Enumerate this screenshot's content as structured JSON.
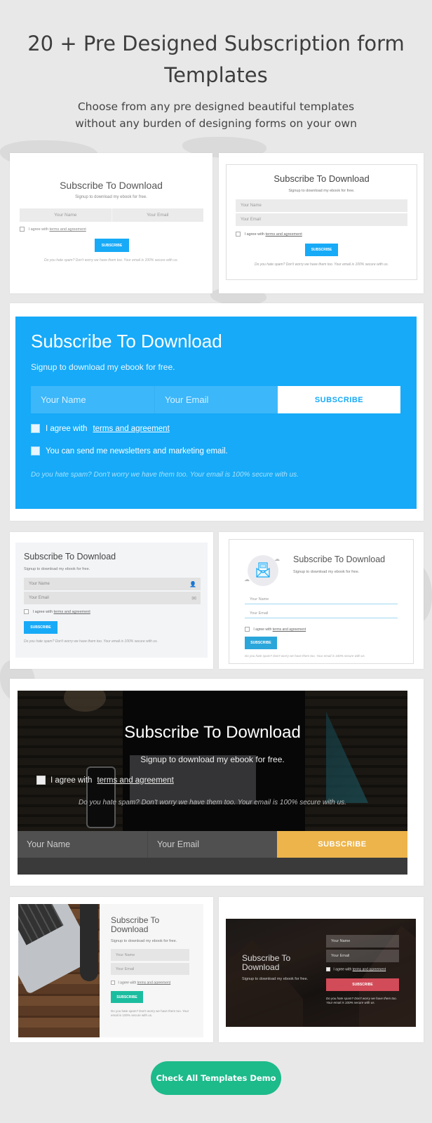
{
  "hero": {
    "title": "20 + Pre Designed Subscription form Templates",
    "subtitle_line1": "Choose from any pre designed beautiful templates",
    "subtitle_line2": "without any burden of designing forms on your own"
  },
  "common": {
    "form_title": "Subscribe To Download",
    "form_subtitle": "Signup to download my ebook for free.",
    "name_placeholder": "Your Name",
    "email_placeholder": "Your Email",
    "agree_prefix": "I agree with",
    "agree_link": "terms and agreement",
    "subscribe_label": "SUBSCRIBE",
    "spam_note": "Do you hate spam? Don't worry we have them too. Your email is 100% secure with us.",
    "newsletter_consent": "You can send me newsletters and marketing email."
  },
  "icons": {
    "user": "👤",
    "mail": "✉",
    "cloud": "☁"
  },
  "colors": {
    "blue_accent": "#17aaf7",
    "teal_accent": "#1bbd9f",
    "yellow_accent": "#ecb44b",
    "red_accent": "#d24b58",
    "cta_green": "#1dba8a"
  },
  "cta": {
    "label": "Check All Templates Demo"
  }
}
